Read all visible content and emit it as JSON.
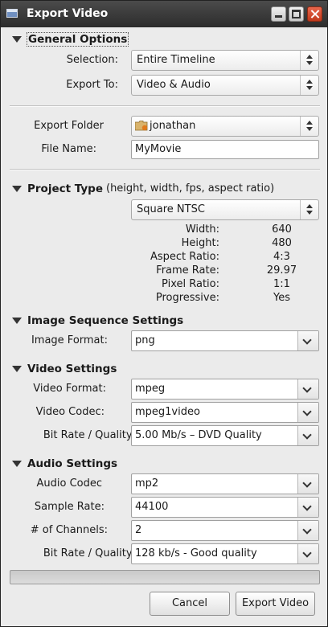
{
  "window": {
    "title": "Export Video",
    "controls": [
      "minimize-icon",
      "maximize-icon",
      "close-icon"
    ]
  },
  "general": {
    "header": "General Options",
    "selection_label": "Selection:",
    "selection_value": "Entire Timeline",
    "export_to_label": "Export To:",
    "export_to_value": "Video & Audio",
    "export_folder_label": "Export Folder",
    "export_folder_value": "jonathan",
    "file_name_label": "File Name:",
    "file_name_value": "MyMovie"
  },
  "project": {
    "header": "Project Type",
    "subtitle": "(height, width, fps, aspect ratio)",
    "type_value": "Square NTSC",
    "info": [
      {
        "label": "Width:",
        "value": "640"
      },
      {
        "label": "Height:",
        "value": "480"
      },
      {
        "label": "Aspect Ratio:",
        "value": "4:3"
      },
      {
        "label": "Frame Rate:",
        "value": "29.97"
      },
      {
        "label": "Pixel Ratio:",
        "value": "1:1"
      },
      {
        "label": "Progressive:",
        "value": "Yes"
      }
    ]
  },
  "image_seq": {
    "header": "Image Sequence Settings",
    "format_label": "Image Format:",
    "format_value": "png"
  },
  "video": {
    "header": "Video Settings",
    "format_label": "Video Format:",
    "format_value": "mpeg",
    "codec_label": "Video Codec:",
    "codec_value": "mpeg1video",
    "bitrate_label": "Bit Rate / Quality:",
    "bitrate_value": "5.00 Mb/s – DVD Quality"
  },
  "audio": {
    "header": "Audio Settings",
    "codec_label": "Audio Codec",
    "codec_value": "mp2",
    "sample_label": "Sample Rate:",
    "sample_value": "44100",
    "channels_label": "# of Channels:",
    "channels_value": "2",
    "bitrate_label": "Bit Rate / Quality:",
    "bitrate_value": "128 kb/s - Good quality"
  },
  "progress": {
    "fraction": 0
  },
  "buttons": {
    "cancel": "Cancel",
    "export": "Export Video"
  },
  "colors": {
    "close_button": "#c0391b",
    "folder_accent": "#e07a1c"
  }
}
